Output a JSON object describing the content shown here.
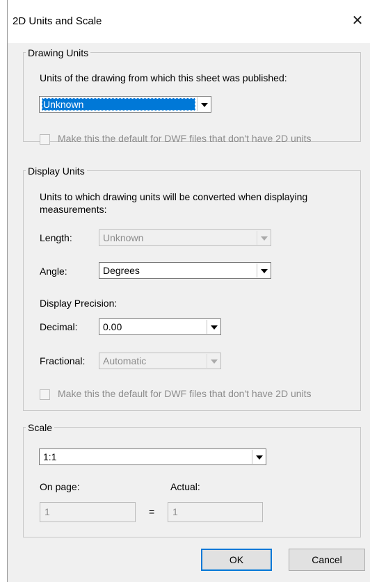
{
  "window": {
    "title": "2D Units and Scale",
    "close_glyph": "✕"
  },
  "drawing_units": {
    "legend": "Drawing Units",
    "legend_accel": "U",
    "prompt": "Units of the drawing from which this sheet was published:",
    "select_value": "Unknown",
    "checkbox_label": "Make this the default for DWF files that don't have 2D units"
  },
  "display_units": {
    "legend": "Display Units",
    "prompt": "Units to which drawing units will be converted when displaying measurements:",
    "length_label": "Length:",
    "length_value": "Unknown",
    "angle_label": "Angle:",
    "angle_value": "Degrees",
    "precision_label": "Display Precision:",
    "decimal_label": "Decimal:",
    "decimal_value": "0.00",
    "fractional_label": "Fractional:",
    "fractional_value": "Automatic",
    "checkbox_label": "Make this the default for DWF files that don't have 2D units"
  },
  "scale": {
    "legend": "Scale",
    "select_value": "1:1",
    "on_page_label": "On page:",
    "actual_label": "Actual:",
    "on_page_value": "1",
    "equals": "=",
    "actual_value": "1"
  },
  "buttons": {
    "ok": "OK",
    "cancel": "Cancel"
  }
}
